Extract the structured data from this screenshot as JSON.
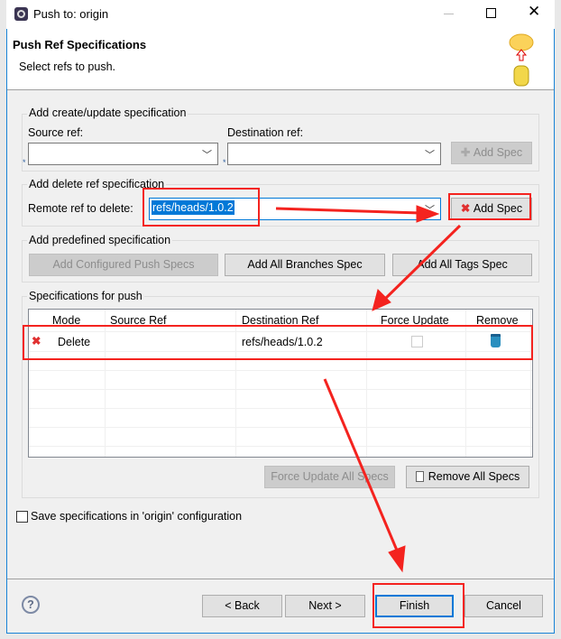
{
  "window": {
    "title": "Push to: origin",
    "controls": [
      "minimize",
      "maximize",
      "close"
    ]
  },
  "header": {
    "title": "Push Ref Specifications",
    "subtitle": "Select refs to push."
  },
  "create_update": {
    "group_label": "Add create/update specification",
    "source_label": "Source ref:",
    "source_value": "",
    "destination_label": "Destination ref:",
    "destination_value": "",
    "add_spec": "Add Spec",
    "required_marker": "*"
  },
  "delete_ref": {
    "group_label": "Add delete ref specification",
    "remote_label": "Remote ref to delete:",
    "remote_value": "refs/heads/1.0.2",
    "add_spec": "Add Spec"
  },
  "predefined": {
    "group_label": "Add predefined specification",
    "buttons": [
      "Add Configured Push Specs",
      "Add All Branches Spec",
      "Add All Tags Spec"
    ]
  },
  "specs": {
    "group_label": "Specifications for push",
    "columns": [
      "Mode",
      "Source Ref",
      "Destination Ref",
      "Force Update",
      "Remove"
    ],
    "rows": [
      {
        "mode": "Delete",
        "source": "",
        "destination": "refs/heads/1.0.2",
        "force_update": false
      }
    ],
    "force_update_all": "Force Update All Specs",
    "remove_all": "Remove All Specs"
  },
  "save_config": {
    "label": "Save specifications in 'origin' configuration",
    "checked": false
  },
  "footer": {
    "back": "< Back",
    "next": "Next >",
    "finish": "Finish",
    "cancel": "Cancel"
  },
  "colors": {
    "accent": "#1883d7",
    "annotation": "#f4231f",
    "selection": "#0078d7"
  }
}
